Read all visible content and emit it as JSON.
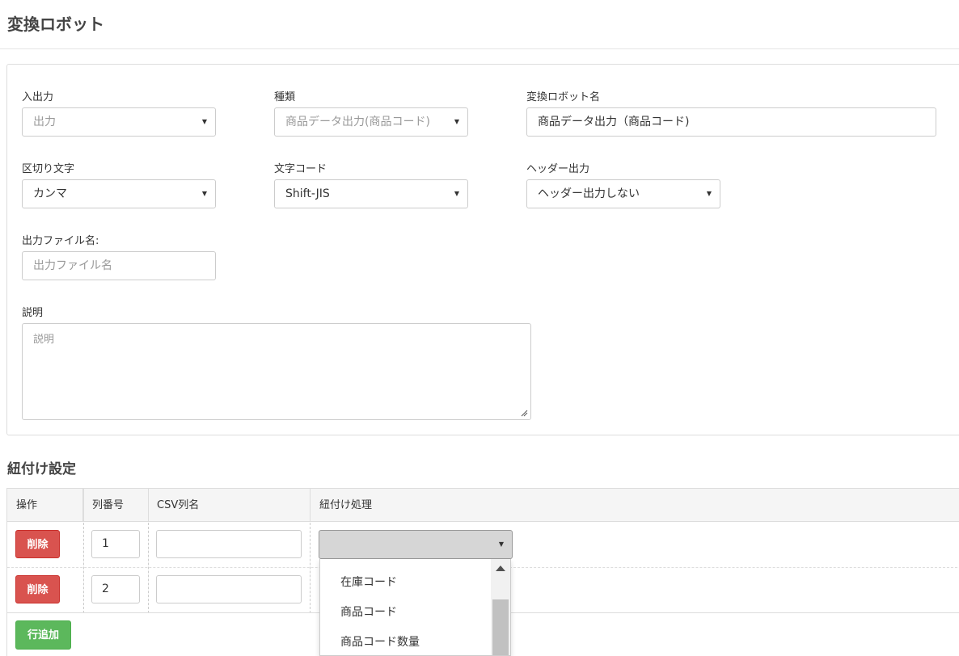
{
  "header": {
    "title": "変換ロボット"
  },
  "form": {
    "io_label": "入出力",
    "io_value": "出力",
    "kind_label": "種類",
    "kind_value": "商品データ出力(商品コード)",
    "robot_name_label": "変換ロボット名",
    "robot_name_value": "商品データ出力（商品コード)",
    "delimiter_label": "区切り文字",
    "delimiter_value": "カンマ",
    "encoding_label": "文字コード",
    "encoding_value": "Shift-JIS",
    "header_output_label": "ヘッダー出力",
    "header_output_value": "ヘッダー出力しない",
    "filename_label": "出力ファイル名:",
    "filename_placeholder": "出力ファイル名",
    "description_label": "説明",
    "description_placeholder": "説明"
  },
  "mapping": {
    "section_title": "紐付け設定",
    "columns": [
      "操作",
      "列番号",
      "CSV列名",
      "紐付け処理"
    ],
    "rows": [
      {
        "delete_label": "削除",
        "column_no": "1",
        "csv_name": ""
      },
      {
        "delete_label": "削除",
        "column_no": "2",
        "csv_name": ""
      }
    ],
    "add_row_label": "行追加",
    "dropdown_options": [
      "在庫コード",
      "商品コード",
      "商品コード数量"
    ]
  },
  "colors": {
    "danger": "#d9534f",
    "success": "#5cb85c"
  },
  "icons": {
    "select_caret": "caret-down-icon",
    "scroll_up": "scroll-up-arrow-icon",
    "textarea_resize": "resize-handle-icon"
  }
}
